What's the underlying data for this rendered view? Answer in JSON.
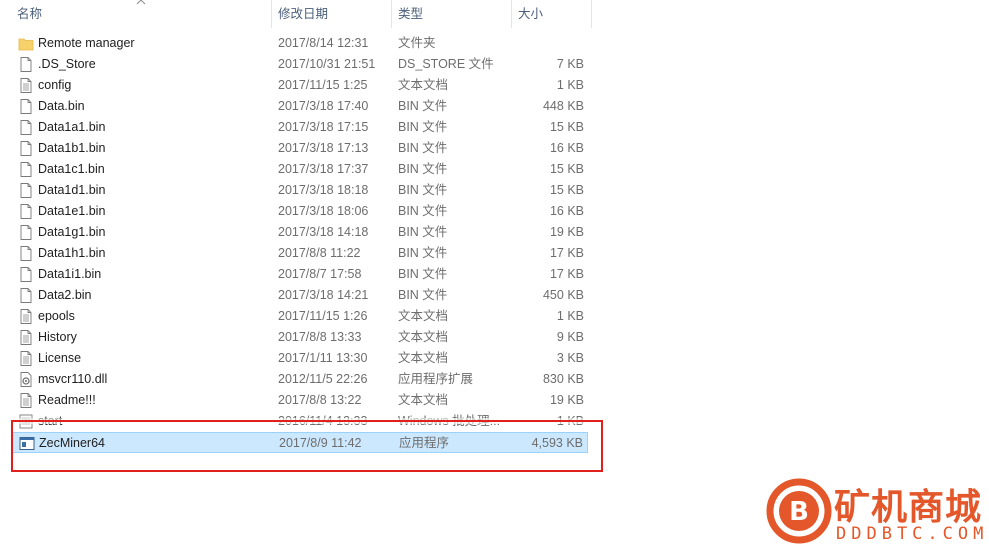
{
  "columns": {
    "name": "名称",
    "date": "修改日期",
    "type": "类型",
    "size": "大小"
  },
  "files": [
    {
      "name": "Remote manager",
      "date": "2017/8/14 12:31",
      "type": "文件夹",
      "size": "",
      "icon": "folder-icon"
    },
    {
      "name": ".DS_Store",
      "date": "2017/10/31 21:51",
      "type": "DS_STORE 文件",
      "size": "7 KB",
      "icon": "file-icon"
    },
    {
      "name": "config",
      "date": "2017/11/15 1:25",
      "type": "文本文档",
      "size": "1 KB",
      "icon": "text-file-icon"
    },
    {
      "name": "Data.bin",
      "date": "2017/3/18 17:40",
      "type": "BIN 文件",
      "size": "448 KB",
      "icon": "file-icon"
    },
    {
      "name": "Data1a1.bin",
      "date": "2017/3/18 17:15",
      "type": "BIN 文件",
      "size": "15 KB",
      "icon": "file-icon"
    },
    {
      "name": "Data1b1.bin",
      "date": "2017/3/18 17:13",
      "type": "BIN 文件",
      "size": "16 KB",
      "icon": "file-icon"
    },
    {
      "name": "Data1c1.bin",
      "date": "2017/3/18 17:37",
      "type": "BIN 文件",
      "size": "15 KB",
      "icon": "file-icon"
    },
    {
      "name": "Data1d1.bin",
      "date": "2017/3/18 18:18",
      "type": "BIN 文件",
      "size": "15 KB",
      "icon": "file-icon"
    },
    {
      "name": "Data1e1.bin",
      "date": "2017/3/18 18:06",
      "type": "BIN 文件",
      "size": "16 KB",
      "icon": "file-icon"
    },
    {
      "name": "Data1g1.bin",
      "date": "2017/3/18 14:18",
      "type": "BIN 文件",
      "size": "19 KB",
      "icon": "file-icon"
    },
    {
      "name": "Data1h1.bin",
      "date": "2017/8/8 11:22",
      "type": "BIN 文件",
      "size": "17 KB",
      "icon": "file-icon"
    },
    {
      "name": "Data1i1.bin",
      "date": "2017/8/7 17:58",
      "type": "BIN 文件",
      "size": "17 KB",
      "icon": "file-icon"
    },
    {
      "name": "Data2.bin",
      "date": "2017/3/18 14:21",
      "type": "BIN 文件",
      "size": "450 KB",
      "icon": "file-icon"
    },
    {
      "name": "epools",
      "date": "2017/11/15 1:26",
      "type": "文本文档",
      "size": "1 KB",
      "icon": "text-file-icon"
    },
    {
      "name": "History",
      "date": "2017/8/8 13:33",
      "type": "文本文档",
      "size": "9 KB",
      "icon": "text-file-icon"
    },
    {
      "name": "License",
      "date": "2017/1/11 13:30",
      "type": "文本文档",
      "size": "3 KB",
      "icon": "text-file-icon"
    },
    {
      "name": "msvcr110.dll",
      "date": "2012/11/5 22:26",
      "type": "应用程序扩展",
      "size": "830 KB",
      "icon": "dll-file-icon"
    },
    {
      "name": "Readme!!!",
      "date": "2017/8/8 13:22",
      "type": "文本文档",
      "size": "19 KB",
      "icon": "text-file-icon"
    },
    {
      "name": "start",
      "date": "2016/11/4 13:33",
      "type": "Windows 批处理...",
      "size": "1 KB",
      "icon": "batch-file-icon"
    },
    {
      "name": "ZecMiner64",
      "date": "2017/8/9 11:42",
      "type": "应用程序",
      "size": "4,593 KB",
      "icon": "application-icon",
      "selected": true
    }
  ],
  "watermark": {
    "title": "矿机商城",
    "subtitle": "DDDBTC.COM",
    "logo_glyph": "B"
  },
  "colors": {
    "selection_bg": "#cce8ff",
    "selection_border": "#99d1ff",
    "highlight_box": "#e0201c",
    "watermark": "#e3572a",
    "folder": "#f7d26b"
  }
}
